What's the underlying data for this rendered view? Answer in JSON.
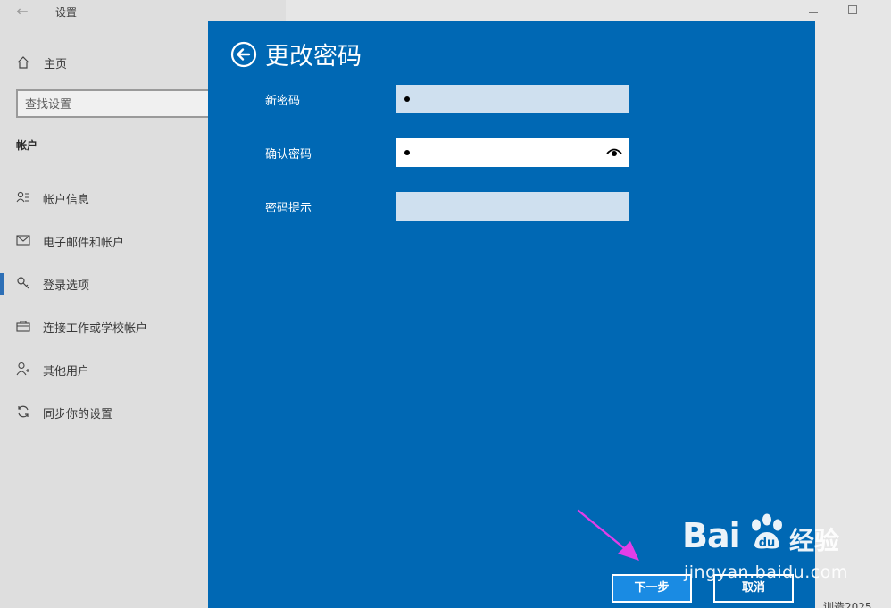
{
  "window": {
    "title": "设置",
    "back_icon": "back-arrow-icon",
    "minimize_icon": "minimize-icon",
    "maximize_icon": "maximize-icon"
  },
  "sidebar": {
    "home_label": "主页",
    "search_placeholder": "查找设置",
    "section_title": "帐户",
    "items": [
      {
        "label": "帐户信息",
        "icon": "account-info-icon",
        "active": false
      },
      {
        "label": "电子邮件和帐户",
        "icon": "mail-icon",
        "active": false
      },
      {
        "label": "登录选项",
        "icon": "key-icon",
        "active": true
      },
      {
        "label": "连接工作或学校帐户",
        "icon": "briefcase-icon",
        "active": false
      },
      {
        "label": "其他用户",
        "icon": "person-add-icon",
        "active": false
      },
      {
        "label": "同步你的设置",
        "icon": "sync-icon",
        "active": false
      }
    ]
  },
  "dialog": {
    "title": "更改密码",
    "fields": [
      {
        "label": "新密码",
        "value": "●",
        "focused": false
      },
      {
        "label": "确认密码",
        "value": "●",
        "focused": true
      },
      {
        "label": "密码提示",
        "value": "",
        "focused": false
      }
    ],
    "next_label": "下一步",
    "cancel_label": "取消"
  },
  "bottom_text": "训造2025",
  "watermark": {
    "brand_latin": "Bai",
    "brand_cn": "经验",
    "url": "jingyan.baidu.com"
  },
  "colors": {
    "dialog_bg": "#0068b4",
    "field_bg": "#cfe0ef",
    "accent_bar": "#2d6fb6",
    "arrow_annotation": "#e23ee8"
  }
}
